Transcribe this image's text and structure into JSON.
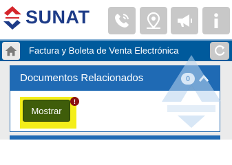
{
  "brand": {
    "name": "SUNAT",
    "text_color": "#1d3b87",
    "mark_red": "#d5262c",
    "mark_blue": "#1d3b87"
  },
  "toolbar": {
    "items": [
      {
        "icon": "phone-icon"
      },
      {
        "icon": "map-pin-icon"
      },
      {
        "icon": "megaphone-icon"
      },
      {
        "icon": "info-icon"
      }
    ],
    "button_color": "#c8c8c8"
  },
  "header": {
    "title": "Factura y Boleta de Venta Electrónica",
    "background": "#005a9c",
    "home_icon": "home-icon",
    "refresh_icon": "refresh-icon"
  },
  "panel": {
    "title": "Documentos Relacionados",
    "count": "0",
    "expand_icon": "chevron-up-icon",
    "header_color": "#1f6ab4",
    "action": {
      "label": "Mostrar",
      "color": "#3f5d0a",
      "highlight_color": "#f4ee1a",
      "alert_badge": "!"
    }
  }
}
